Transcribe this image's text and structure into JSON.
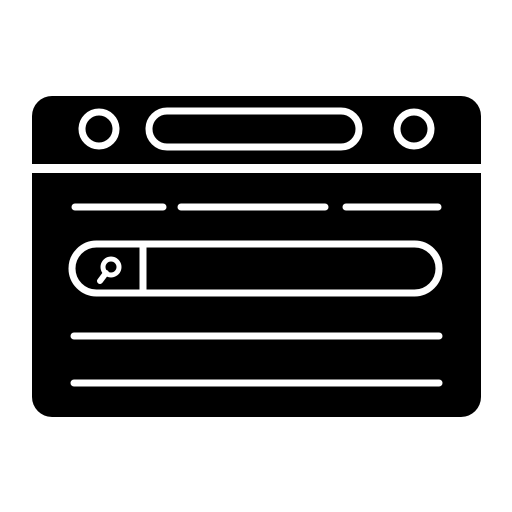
{
  "icon": {
    "name": "web-search-browser-window-icon",
    "colors": {
      "foreground": "#000000",
      "background": "#ffffff"
    },
    "parts": {
      "window": "browser-window-icon",
      "left_control": "circle-button-icon",
      "address_bar": "address-bar-icon",
      "right_control": "circle-button-icon",
      "search_box": "search-bar-icon",
      "search_glyph": "magnifier-icon",
      "content_lines": "text-line-icon"
    }
  }
}
